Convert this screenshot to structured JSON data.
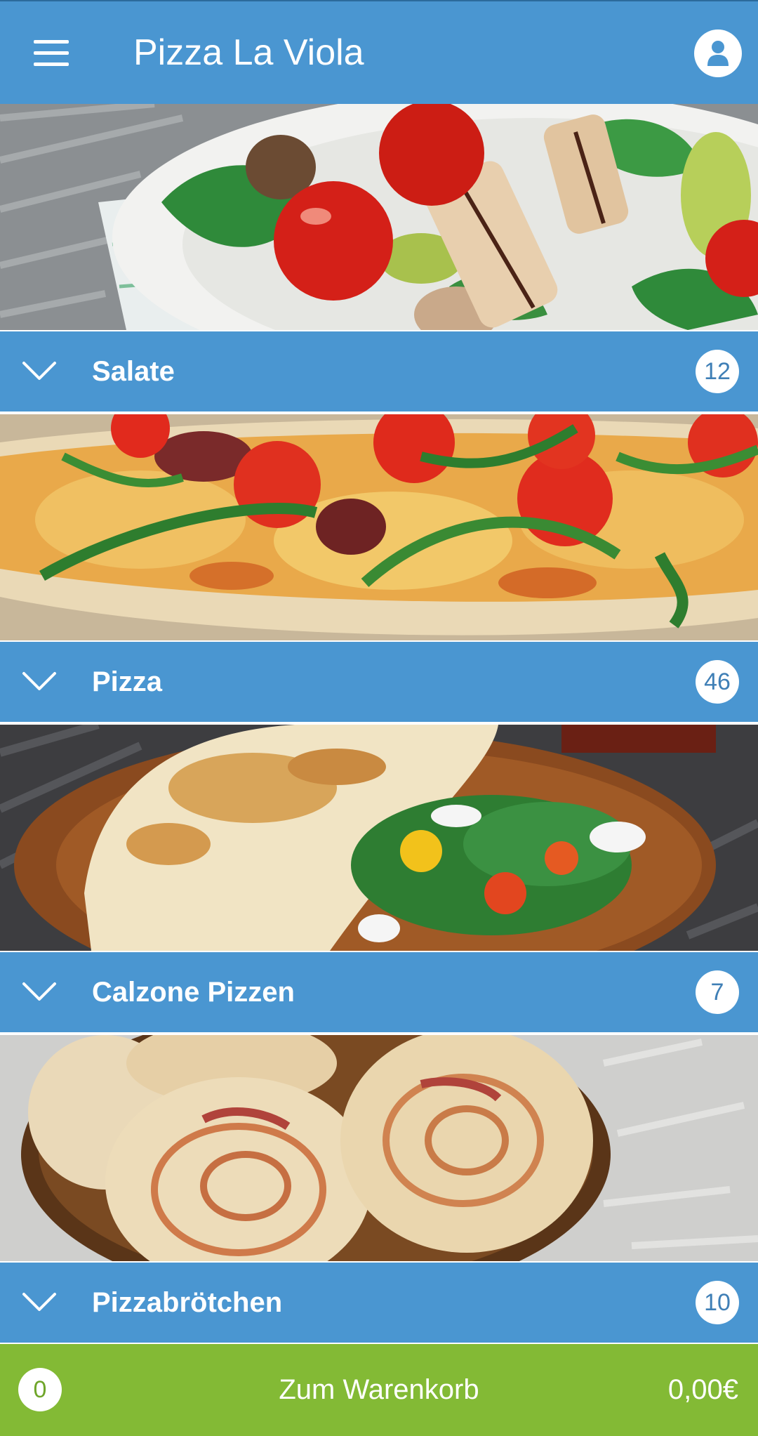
{
  "app": {
    "title": "Pizza La Viola",
    "menu_icon": "hamburger-menu-icon",
    "profile_icon": "user-profile-icon"
  },
  "colors": {
    "primary": "#4a96d1",
    "cart_bar": "#83ba35",
    "badge_text": "#3f7fb6",
    "white": "#ffffff"
  },
  "categories": [
    {
      "name": "Salate",
      "count": "12",
      "image": "salad-photo"
    },
    {
      "name": "Pizza",
      "count": "46",
      "image": "pizza-photo"
    },
    {
      "name": "Calzone Pizzen",
      "count": "7",
      "image": "calzone-photo"
    },
    {
      "name": "Pizzabrötchen",
      "count": "10",
      "image": "pizza-rolls-photo"
    }
  ],
  "cart": {
    "item_count": "0",
    "label": "Zum Warenkorb",
    "total": "0,00€"
  }
}
